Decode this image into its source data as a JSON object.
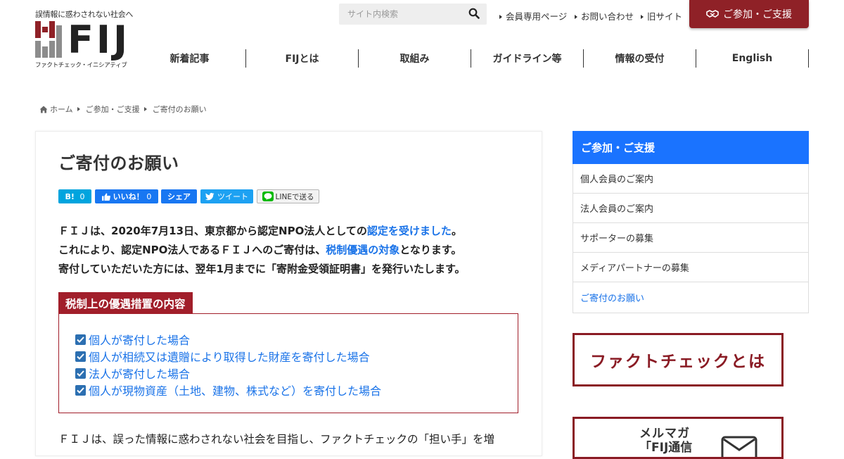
{
  "header": {
    "tagline": "誤情報に惑わされない社会へ",
    "logo_text": "FIJ",
    "logo_subtitle": "ファクトチェック・イニシアティブ",
    "search_placeholder": "サイト内検索",
    "top_links": [
      "会員専用ページ",
      "お問い合わせ",
      "旧サイト"
    ],
    "join_button": "ご参加・ご支援",
    "brand_color": "#8f2127"
  },
  "global_nav": [
    "新着記事",
    "FIJとは",
    "取組み",
    "ガイドライン等",
    "情報の受付",
    "English"
  ],
  "breadcrumb": [
    "ホーム",
    "ご参加・ご支援",
    "ご寄付のお願い"
  ],
  "main": {
    "title": "ご寄付のお願い",
    "share": {
      "hatena_label": "B!",
      "hatena_count": "0",
      "fb_like_label": "いいね！",
      "fb_like_count": "0",
      "fb_share_label": "シェア",
      "tweet_label": "ツイート",
      "line_label": "LINEで送る"
    },
    "intro": {
      "line1_a": "ＦＩＪは、2020年7月13日、東京都から認定NPO法人としての",
      "line1_link": "認定を受けました",
      "line1_b": "。",
      "line2_a": "これにより、認定NPO法人であるＦＩＪへのご寄付は、",
      "line2_link": "税制優遇の対象",
      "line2_b": "となります。",
      "line3": "寄付していただいた方には、翌年1月までに「寄附金受領証明書」を発行いたします。"
    },
    "tax_box": {
      "label": "税制上の優遇措置の内容",
      "items": [
        "個人が寄付した場合",
        "個人が相続又は遺贈により取得した財産を寄付した場合",
        "法人が寄付した場合",
        "個人が現物資産（土地、建物、株式など）を寄付した場合"
      ]
    },
    "closing": "ＦＩＪは、誤った情報に惑わされない社会を目指し、ファクトチェックの「担い手」を増"
  },
  "sidebar": {
    "heading": "ご参加・ご支援",
    "items": [
      "個人会員のご案内",
      "法人会員のご案内",
      "サポーターの募集",
      "メディアパートナーの募集",
      "ご寄付のお願い"
    ],
    "banner1": "ファクトチェックとは",
    "banner2_line1": "メルマガ",
    "banner2_line2": "「FIJ通信"
  }
}
